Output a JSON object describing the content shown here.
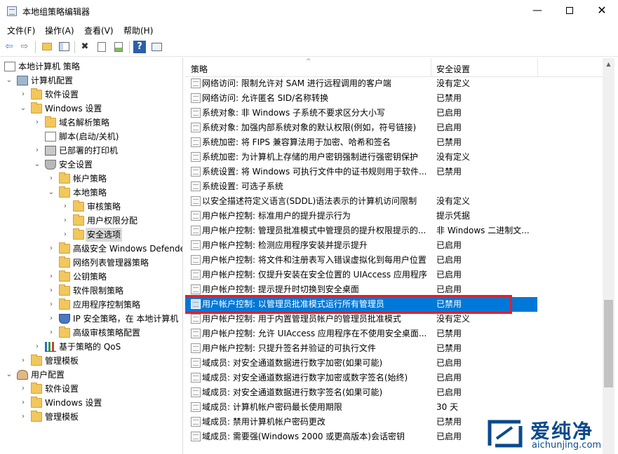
{
  "window": {
    "title": "本地组策略编辑器",
    "minimize_glyph": "—",
    "close_glyph": "✕"
  },
  "menu": [
    "文件(F)",
    "操作(A)",
    "查看(V)",
    "帮助(H)"
  ],
  "toolbar": {
    "icons": [
      "back-arrow-icon",
      "forward-arrow-icon",
      "folder-up-icon",
      "show-hide-tree-icon",
      "delete-icon",
      "properties-icon",
      "export-list-icon",
      "help-icon",
      "console-tree-icon"
    ],
    "glyphs": {
      "back": "⇦",
      "forward": "⇨",
      "delete": "✖",
      "help": "?"
    }
  },
  "tree": {
    "root": "本地计算机 策略",
    "computer_config": "计算机配置",
    "software_settings": "软件设置",
    "windows_settings": "Windows 设置",
    "name_resolution": "域名解析策略",
    "scripts": "脚本(启动/关机)",
    "printers": "已部署的打印机",
    "security_settings": "安全设置",
    "account_policies": "帐户策略",
    "local_policies": "本地策略",
    "audit_policy": "审核策略",
    "user_rights": "用户权限分配",
    "security_options": "安全选项",
    "firewall": "高级安全 Windows Defende",
    "network_list": "网络列表管理器策略",
    "public_key": "公钥策略",
    "software_restriction": "软件限制策略",
    "app_control": "应用程序控制策略",
    "ip_security": "IP 安全策略，在 本地计算机",
    "advanced_audit": "高级审核策略配置",
    "qos": "基于策略的 QoS",
    "admin_templates": "管理模板",
    "user_config": "用户配置",
    "u_software_settings": "软件设置",
    "u_windows_settings": "Windows 设置",
    "u_admin_templates": "管理模板",
    "expand_glyph": "›",
    "collapse_glyph": "⌄"
  },
  "list": {
    "col_policy": "策略",
    "col_setting": "安全设置",
    "sort_glyph": "^",
    "rows": [
      {
        "name": "网络访问: 限制允许对 SAM 进行远程调用的客户端",
        "value": "没有定义"
      },
      {
        "name": "网络访问: 允许匿名 SID/名称转换",
        "value": "已禁用"
      },
      {
        "name": "系统对象: 非 Windows 子系统不要求区分大小写",
        "value": "已启用"
      },
      {
        "name": "系统对象: 加强内部系统对象的默认权限(例如，符号链接)",
        "value": "已启用"
      },
      {
        "name": "系统加密: 将 FIPS 兼容算法用于加密、哈希和签名",
        "value": "已禁用"
      },
      {
        "name": "系统加密: 为计算机上存储的用户密钥强制进行强密钥保护",
        "value": "没有定义"
      },
      {
        "name": "系统设置: 将 Windows 可执行文件中的证书规则用于软件...",
        "value": "已禁用"
      },
      {
        "name": "系统设置: 可选子系统",
        "value": ""
      },
      {
        "name": "以安全描述符定义语言(SDDL)语法表示的计算机访问限制",
        "value": "没有定义"
      },
      {
        "name": "用户帐户控制: 标准用户的提升提示行为",
        "value": "提示凭据"
      },
      {
        "name": "用户帐户控制: 管理员批准模式中管理员的提升权限提示的...",
        "value": "非 Windows 二进制文..."
      },
      {
        "name": "用户帐户控制: 检测应用程序安装并提示提升",
        "value": "已启用"
      },
      {
        "name": "用户帐户控制: 将文件和注册表写入错误虚拟化到每用户位置",
        "value": "已启用"
      },
      {
        "name": "用户帐户控制: 仅提升安装在安全位置的 UIAccess 应用程序",
        "value": "已启用"
      },
      {
        "name": "用户帐户控制: 提示提升时切换到安全桌面",
        "value": "已启用"
      },
      {
        "name": "用户帐户控制: 以管理员批准模式运行所有管理员",
        "value": "已禁用",
        "selected": true
      },
      {
        "name": "用户帐户控制: 用于内置管理员帐户的管理员批准模式",
        "value": "没有定义"
      },
      {
        "name": "用户帐户控制: 允许 UIAccess 应用程序在不使用安全桌面...",
        "value": "已禁用"
      },
      {
        "name": "用户帐户控制: 只提升签名并验证的可执行文件",
        "value": "已禁用"
      },
      {
        "name": "域成员: 对安全通道数据进行数字加密(如果可能)",
        "value": "已启用"
      },
      {
        "name": "域成员: 对安全通道数据进行数字加密或数字签名(始终)",
        "value": "已启用"
      },
      {
        "name": "域成员: 对安全通道数据进行数字签名(如果可能)",
        "value": "已启用"
      },
      {
        "name": "域成员: 计算机帐户密码最长使用期限",
        "value": "30 天"
      },
      {
        "name": "域成员: 禁用计算机帐户密码更改",
        "value": "已禁用"
      },
      {
        "name": "域成员: 需要强(Windows 2000 或更高版本)会话密钥",
        "value": "已启用"
      }
    ]
  },
  "scrollbar": {
    "up_glyph": "▲"
  },
  "watermark": {
    "title": "爱纯净",
    "url": "aichunjing.com",
    "logo_color": "#0a4a8c"
  },
  "colors": {
    "selection": "#0078d7",
    "highlight_border": "#e0202a"
  }
}
